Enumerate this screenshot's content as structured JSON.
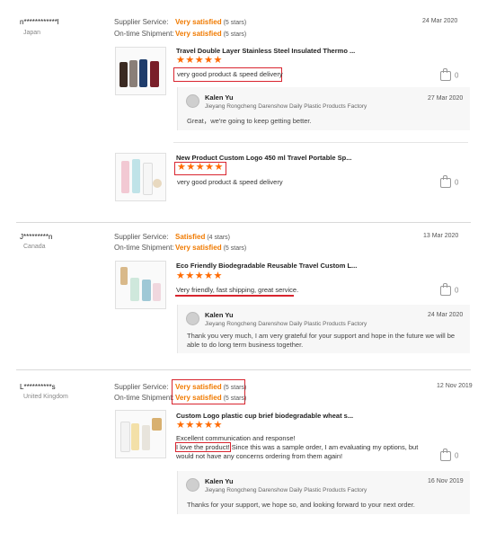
{
  "reviews": [
    {
      "user": "n************l",
      "country": "Japan",
      "date": "24 Mar 2020",
      "supplier_label": "Supplier Service:",
      "supplier_value": "Very satisfied",
      "supplier_stars": "(5 stars)",
      "shipment_label": "On-time Shipment:",
      "shipment_value": "Very satisfied",
      "shipment_stars": "(5 stars)",
      "items": [
        {
          "product": "Travel Double Layer Stainless Steel Insulated Thermo ...",
          "rating": "★★★★★",
          "text": "very good product & speed delivery",
          "likes": "0",
          "reply": {
            "name": "Kalen Yu",
            "company": "Jieyang Rongcheng Darenshow Daily Plastic Products Factory",
            "date": "27 Mar 2020",
            "text": "Great，we're going to keep getting better."
          }
        },
        {
          "product": "New Product Custom Logo 450 ml Travel Portable Sp...",
          "rating": "★★★★★",
          "text": "very good product & speed delivery",
          "likes": "0"
        }
      ]
    },
    {
      "user": "J*********n",
      "country": "Canada",
      "date": "13 Mar 2020",
      "supplier_label": "Supplier Service:",
      "supplier_value": "Satisfied",
      "supplier_stars": "(4 stars)",
      "shipment_label": "On-time Shipment:",
      "shipment_value": "Very satisfied",
      "shipment_stars": "(5 stars)",
      "items": [
        {
          "product": "Eco Friendly Biodegradable Reusable Travel Custom L...",
          "rating": "★★★★★",
          "text": "Very friendly, fast shipping, great service.",
          "likes": "0",
          "reply": {
            "name": "Kalen Yu",
            "company": "Jieyang Rongcheng Darenshow Daily Plastic Products Factory",
            "date": "24 Mar 2020",
            "text": "Thank you very much, I am very grateful for your support and hope in the future we will be able to do long term business together."
          }
        }
      ]
    },
    {
      "user": "L**********s",
      "country": "United Kingdom",
      "date": "12 Nov 2019",
      "supplier_label": "Supplier Service:",
      "supplier_value": "Very satisfied",
      "supplier_stars": "(5 stars)",
      "shipment_label": "On-time Shipment:",
      "shipment_value": "Very satisfied",
      "shipment_stars": "(5 stars)",
      "items": [
        {
          "product": "Custom Logo plastic cup brief biodegradable wheat s...",
          "rating": "★★★★★",
          "text_line1": "Excellent communication and response!",
          "text_highlight": "I love the product!",
          "text_rest": " Since this was a sample order, I am evaluating my options, but would not have any concerns ordering from them again!",
          "likes": "0",
          "reply": {
            "name": "Kalen Yu",
            "company": "Jieyang Rongcheng Darenshow Daily Plastic Products Factory",
            "date": "16 Nov 2019",
            "text": "Thanks for your support, we hope so, and looking forward to your next order."
          }
        }
      ]
    }
  ]
}
